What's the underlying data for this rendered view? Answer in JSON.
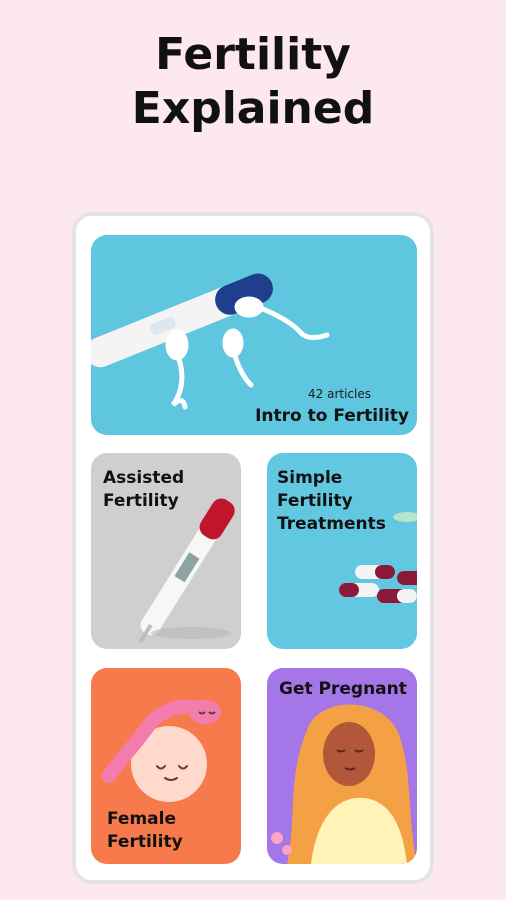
{
  "headline": {
    "line1": "Fertility",
    "line2": "Explained"
  },
  "cards": {
    "intro": {
      "count": "42 articles",
      "title": "Intro to Fertility"
    },
    "assisted": {
      "line1": "Assisted",
      "line2": "Fertility"
    },
    "simple": {
      "line1": "Simple",
      "line2": "Fertility",
      "line3": "Treatments"
    },
    "female": {
      "line1": "Female",
      "line2": "Fertility"
    },
    "pregnant": {
      "title": "Get Pregnant"
    }
  },
  "colors": {
    "background": "#fce8ee",
    "intro": "#5fc6e0",
    "assisted": "#cfcfcf",
    "simple": "#62c8e2",
    "female": "#f67a4c",
    "pregnant": "#a476e8"
  },
  "icons": [
    "pregnancy-test-icon",
    "sperm-icon",
    "thermometer-icon",
    "pill-capsules-icon",
    "egg-sperm-icon",
    "woman-illustration-icon"
  ]
}
